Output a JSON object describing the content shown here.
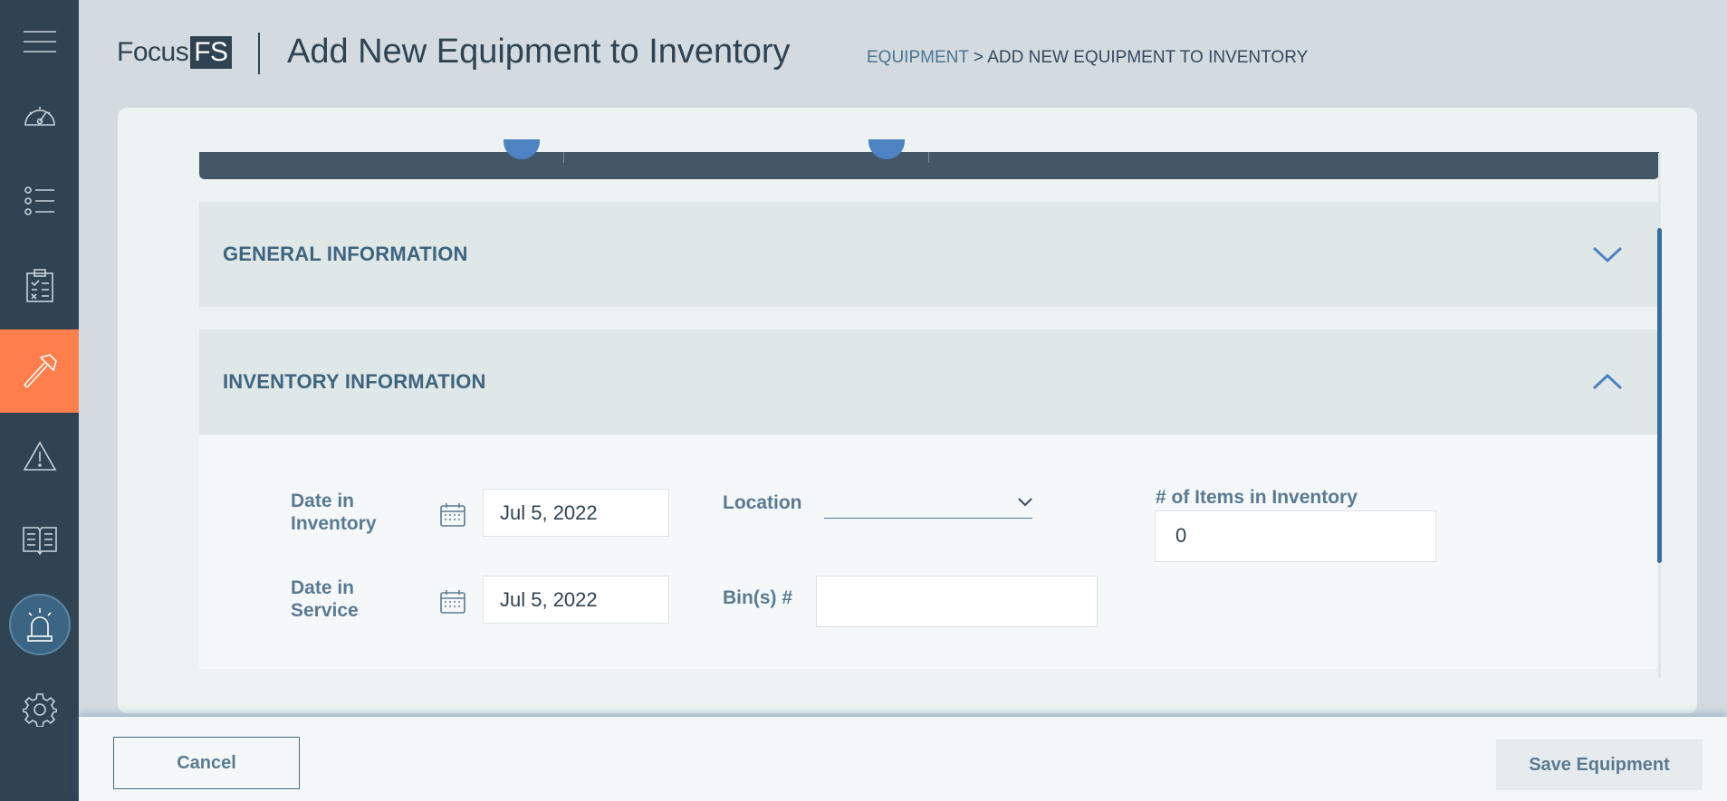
{
  "app": {
    "logo_text": "Focus",
    "logo_badge": "FS",
    "page_title": "Add New Equipment to Inventory"
  },
  "breadcrumb": {
    "parent": "EQUIPMENT",
    "separator": " > ",
    "current": "ADD NEW EQUIPMENT TO INVENTORY"
  },
  "sidebar": {
    "items": [
      {
        "name": "menu",
        "icon": "hamburger-icon"
      },
      {
        "name": "dashboard",
        "icon": "gauge-icon"
      },
      {
        "name": "list",
        "icon": "list-icon"
      },
      {
        "name": "checklist",
        "icon": "clipboard-icon"
      },
      {
        "name": "equipment",
        "icon": "hammer-icon",
        "active": true
      },
      {
        "name": "alerts",
        "icon": "warning-icon"
      },
      {
        "name": "manuals",
        "icon": "book-icon"
      },
      {
        "name": "alarm",
        "icon": "alarm-icon"
      },
      {
        "name": "settings",
        "icon": "gear-icon"
      }
    ],
    "accent_color": "#ff7f4c"
  },
  "sections": {
    "general": {
      "title": "GENERAL INFORMATION",
      "expanded": false
    },
    "inventory": {
      "title": "INVENTORY INFORMATION",
      "expanded": true
    }
  },
  "form": {
    "date_in_inventory": {
      "label_line1": "Date in",
      "label_line2": "Inventory",
      "value": "Jul 5, 2022"
    },
    "date_in_service": {
      "label_line1": "Date in",
      "label_line2": "Service",
      "value": "Jul 5, 2022"
    },
    "location": {
      "label": "Location",
      "value": ""
    },
    "bins": {
      "label": "Bin(s) #",
      "value": ""
    },
    "items_in_inventory": {
      "label": "# of Items in Inventory",
      "value": "0"
    }
  },
  "footer": {
    "cancel_label": "Cancel",
    "save_label": "Save Equipment"
  }
}
